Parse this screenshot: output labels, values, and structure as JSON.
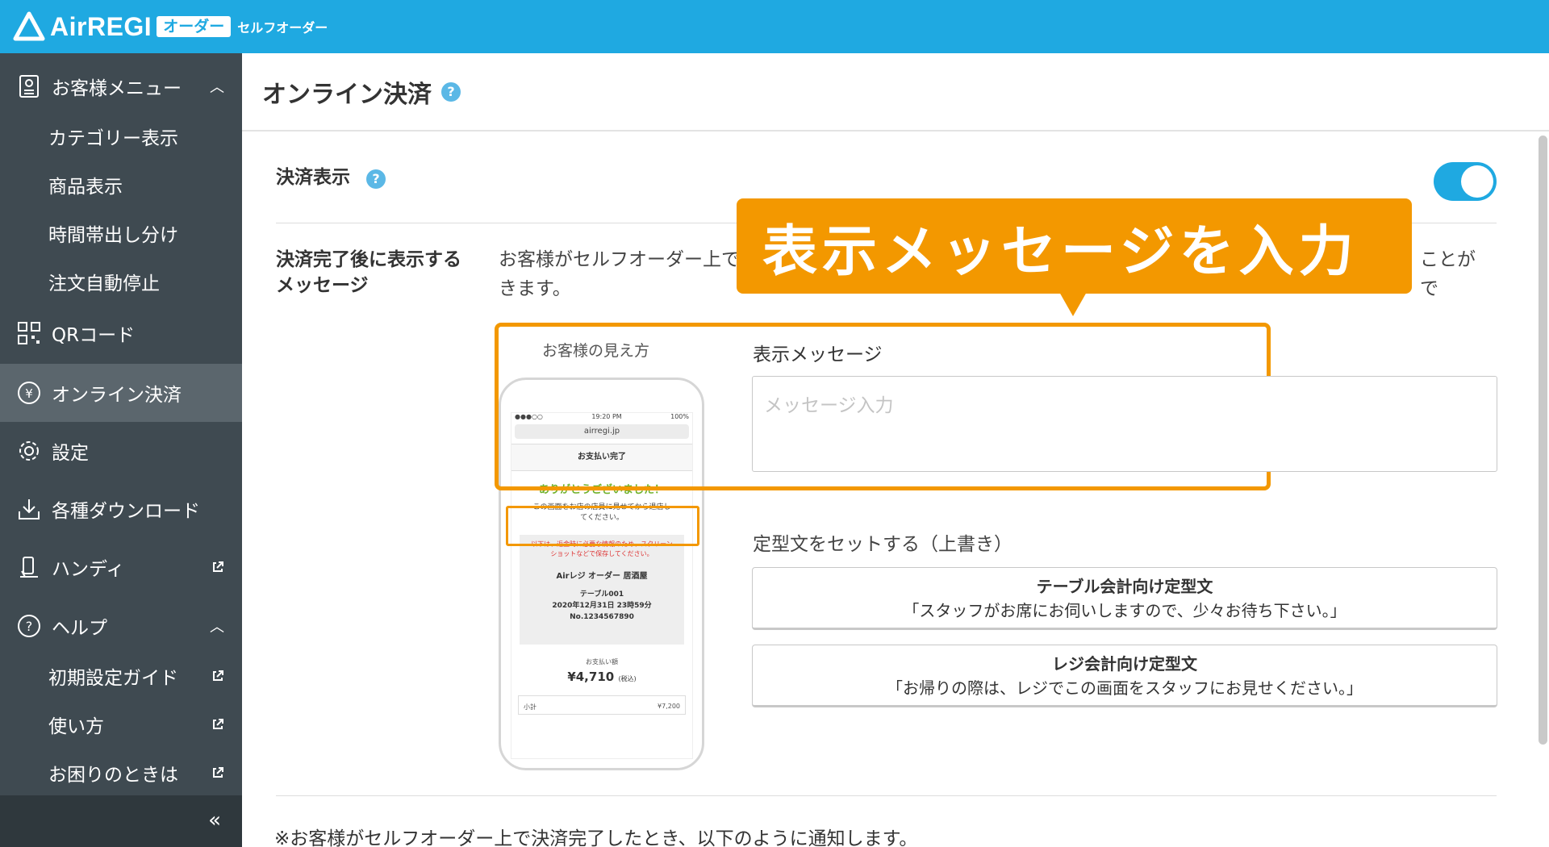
{
  "header": {
    "brand": "AirREGI",
    "badge": "オーダー",
    "subtitle": "セルフオーダー"
  },
  "sidebar": {
    "items": [
      {
        "label": "お客様メニュー",
        "icon": "menu-book-icon"
      },
      {
        "label": "カテゴリー表示"
      },
      {
        "label": "商品表示"
      },
      {
        "label": "時間帯出し分け"
      },
      {
        "label": "注文自動停止"
      },
      {
        "label": "QRコード",
        "icon": "qr-code-icon"
      },
      {
        "label": "オンライン決済",
        "icon": "yen-icon"
      },
      {
        "label": "設定",
        "icon": "gear-icon"
      },
      {
        "label": "各種ダウンロード",
        "icon": "download-icon"
      },
      {
        "label": "ハンディ",
        "icon": "handy-icon"
      },
      {
        "label": "ヘルプ",
        "icon": "help-icon"
      },
      {
        "label": "初期設定ガイド"
      },
      {
        "label": "使い方"
      },
      {
        "label": "お困りのときは"
      }
    ],
    "collapse": "«"
  },
  "main": {
    "title": "オンライン決済",
    "payment_display_label": "決済表示",
    "message_section_label": "決済完了後に表示するメッセージ",
    "description_line1": "お客様がセルフオーダー上で",
    "description_line1_end": "ことがで",
    "description_line2": "きます。",
    "preview_caption": "お客様の見え方",
    "message_label": "表示メッセージ",
    "message_placeholder": "メッセージ入力",
    "message_value": "",
    "template_label": "定型文をセットする（上書き）",
    "templates": [
      {
        "title": "テーブル会計向け定型文",
        "text": "「スタッフがお席にお伺いしますので、少々お待ち下さい。」"
      },
      {
        "title": "レジ会計向け定型文",
        "text": "「お帰りの際は、レジでこの画面をスタッフにお見せください。」"
      }
    ],
    "footnote": "※お客様がセルフオーダー上で決済完了したとき、以下のように通知します。",
    "toggle_on": true
  },
  "callout": {
    "text": "表示メッセージを入力",
    "color": "#f39800"
  },
  "phone_preview": {
    "time": "19:20 PM",
    "battery": "100%",
    "url": "airregi.jp",
    "screen_title": "お支払い完了",
    "thanks": "ありがとうございました！",
    "message_line1": "この画面をお店の店員に見せてから退店し",
    "message_line2": "てください。",
    "warning_line1": "以下は、返金時に必要な情報のため、スクリーン",
    "warning_line2": "ショットなどで保存してください。",
    "shop": "Airレジ オーダー 居酒屋",
    "table": "テーブル001",
    "datetime": "2020年12月31日 23時59分",
    "number": "No.1234567890",
    "pay_label": "お支払い額",
    "amount": "¥4,710",
    "tax": "(税込)",
    "subtotal_label": "小計",
    "subtotal": "¥7,200"
  },
  "colors": {
    "brand": "#1fa9e1",
    "sidebar": "#3f4a51",
    "accent": "#f39800"
  }
}
